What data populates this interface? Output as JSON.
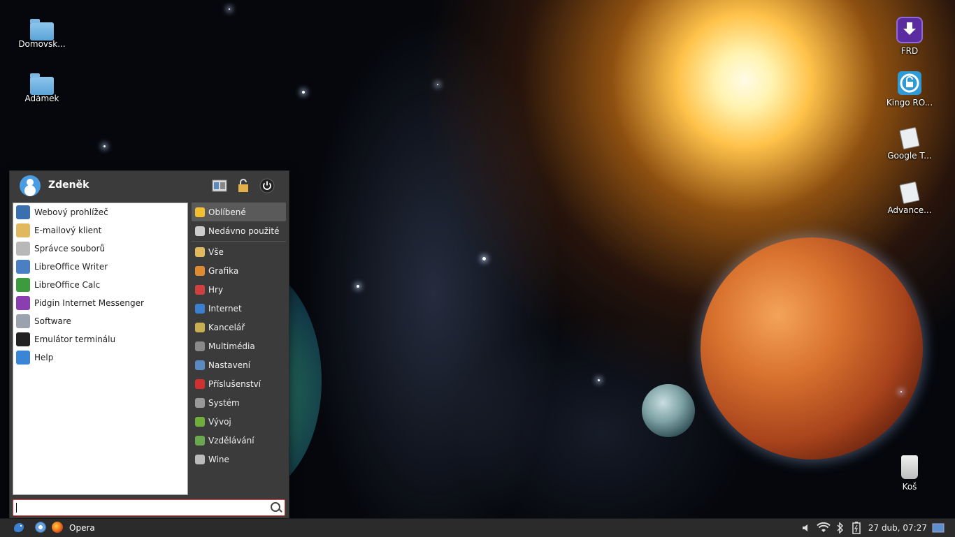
{
  "desktop": {
    "left_icons": [
      {
        "label": "Domovsk..."
      },
      {
        "label": "Adámek"
      }
    ],
    "right_icons": [
      {
        "label": "FRD"
      },
      {
        "label": "Kingo RO..."
      },
      {
        "label": "Google T..."
      },
      {
        "label": "Advance..."
      },
      {
        "label": "Koš"
      }
    ]
  },
  "menu": {
    "user_name": "Zdeněk",
    "favorites": [
      {
        "label": "Webový prohlížeč",
        "icon": "globe-icon",
        "color": "#3a6fb0"
      },
      {
        "label": "E-mailový klient",
        "icon": "mail-icon",
        "color": "#e0b860"
      },
      {
        "label": "Správce souborů",
        "icon": "file-manager-icon",
        "color": "#b8b8b8"
      },
      {
        "label": "LibreOffice Writer",
        "icon": "writer-icon",
        "color": "#4a7fc4"
      },
      {
        "label": "LibreOffice Calc",
        "icon": "calc-icon",
        "color": "#3d9b3d"
      },
      {
        "label": "Pidgin Internet Messenger",
        "icon": "pidgin-icon",
        "color": "#8a3fb0"
      },
      {
        "label": "Software",
        "icon": "software-icon",
        "color": "#9aa3ad"
      },
      {
        "label": "Emulátor terminálu",
        "icon": "terminal-icon",
        "color": "#222222"
      },
      {
        "label": "Help",
        "icon": "help-icon",
        "color": "#3a85d6"
      }
    ],
    "categories": [
      {
        "label": "Oblíbené",
        "icon": "star-icon",
        "color": "#f0c030"
      },
      {
        "label": "Nedávno použité",
        "icon": "recent-icon",
        "color": "#cccccc"
      },
      {
        "label": "Vše",
        "icon": "all-icon",
        "color": "#e0b860"
      },
      {
        "label": "Grafika",
        "icon": "graphics-icon",
        "color": "#e08a30"
      },
      {
        "label": "Hry",
        "icon": "games-icon",
        "color": "#d04040"
      },
      {
        "label": "Internet",
        "icon": "internet-icon",
        "color": "#3a7fd0"
      },
      {
        "label": "Kancelář",
        "icon": "office-icon",
        "color": "#c8b050"
      },
      {
        "label": "Multimédia",
        "icon": "multimedia-icon",
        "color": "#8a8a8a"
      },
      {
        "label": "Nastavení",
        "icon": "settings-icon",
        "color": "#5a8ac0"
      },
      {
        "label": "Příslušenství",
        "icon": "accessories-icon",
        "color": "#d03030"
      },
      {
        "label": "Systém",
        "icon": "system-icon",
        "color": "#999999"
      },
      {
        "label": "Vývoj",
        "icon": "development-icon",
        "color": "#6fae3a"
      },
      {
        "label": "Vzdělávání",
        "icon": "education-icon",
        "color": "#6aa84f"
      },
      {
        "label": "Wine",
        "icon": "wine-icon",
        "color": "#bbbbbb"
      }
    ],
    "search_value": ""
  },
  "taskbar": {
    "apps": [
      {
        "label": "Opera"
      }
    ],
    "clock": "27 dub, 07:27"
  },
  "colors": {
    "menu_bg": "#3b3b3b",
    "selected_category": "#5a5a5a",
    "search_border": "#d94040",
    "taskbar_bg": "#2b2b2b"
  }
}
